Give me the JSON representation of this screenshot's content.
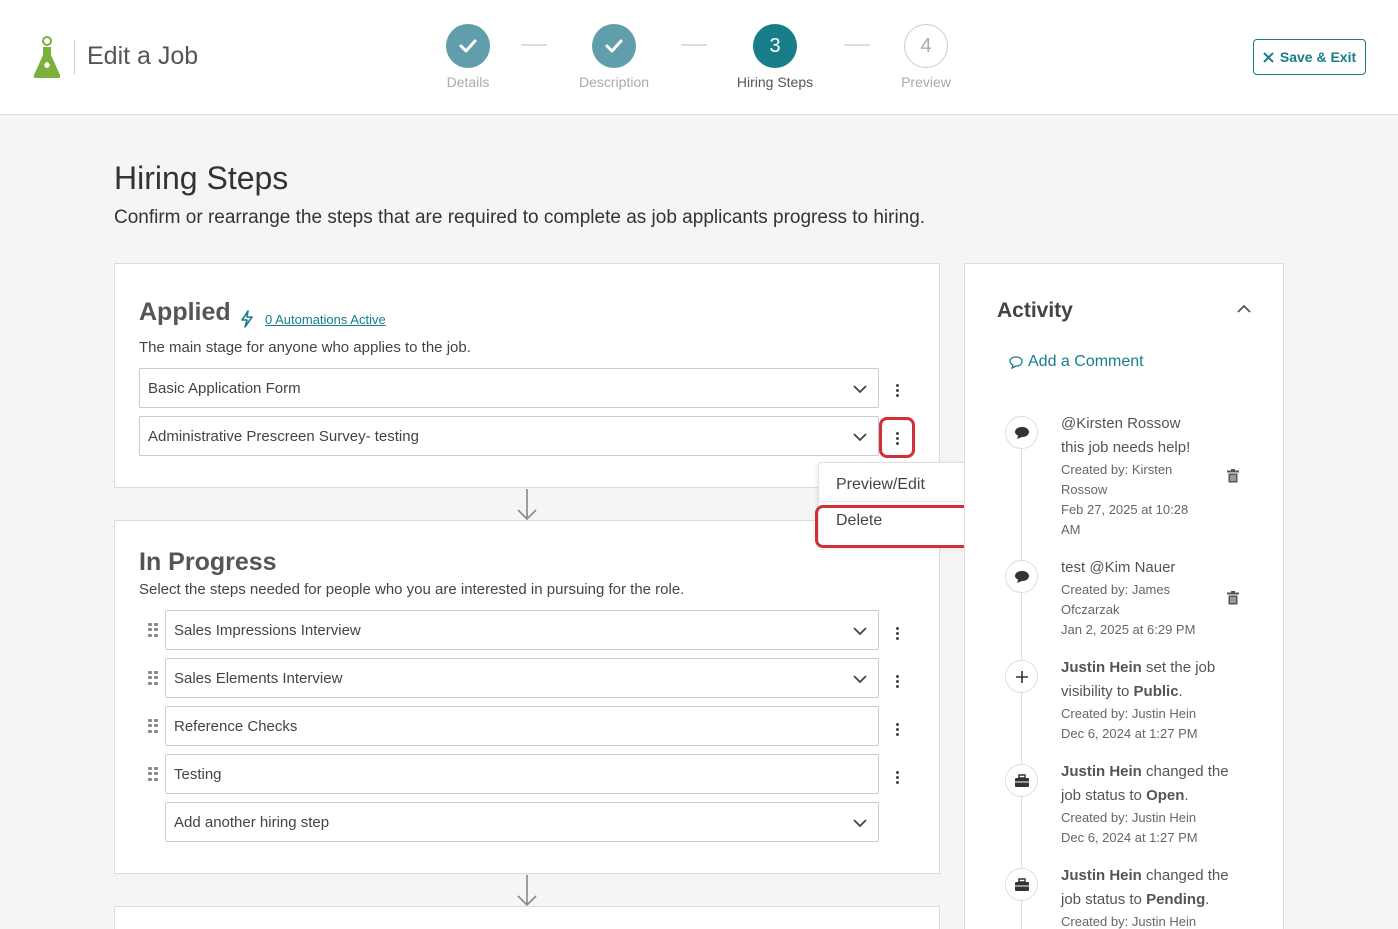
{
  "header": {
    "title": "Edit a Job",
    "save_exit_label": "Save & Exit",
    "steps": [
      {
        "number": "1",
        "label": "Details",
        "status": "done"
      },
      {
        "number": "2",
        "label": "Description",
        "status": "done"
      },
      {
        "number": "3",
        "label": "Hiring Steps",
        "status": "active"
      },
      {
        "number": "4",
        "label": "Preview",
        "status": "todo"
      }
    ]
  },
  "page": {
    "title": "Hiring Steps",
    "subtitle": "Confirm or rearrange the steps that are required to complete as job applicants progress to hiring."
  },
  "stages": {
    "applied": {
      "title": "Applied",
      "automations_link": "0 Automations Active",
      "description": "The main stage for anyone who applies to the job.",
      "steps": [
        "Basic Application Form",
        "Administrative Prescreen Survey- testing"
      ]
    },
    "in_progress": {
      "title": "In Progress",
      "description": "Select the steps needed for people who you are interested in pursuing for the role.",
      "steps": [
        "Sales Impressions Interview",
        "Sales Elements Interview",
        "Reference Checks",
        "Testing"
      ],
      "add_step_placeholder": "Add another hiring step"
    }
  },
  "context_menu": {
    "items": [
      "Preview/Edit",
      "Delete"
    ]
  },
  "activity": {
    "title": "Activity",
    "add_comment_label": "Add a Comment",
    "entries": [
      {
        "icon": "comment-icon",
        "text_lines": [
          "@Kirsten Rossow",
          "this job needs help!"
        ],
        "meta_lines": [
          "Created by: Kirsten",
          "Rossow",
          "Feb 27, 2025 at 10:28",
          "AM"
        ]
      },
      {
        "icon": "comment-icon",
        "text_lines": [
          "test @Kim Nauer"
        ],
        "meta_lines": [
          "Created by: James",
          "Ofczarzak",
          "Jan 2, 2025 at 6:29 PM"
        ]
      },
      {
        "icon": "plus-icon",
        "actor": "Justin Hein",
        "action": "set the job",
        "action2": "visibility to",
        "value": "Public",
        "meta_lines": [
          "Created by: Justin Hein",
          "Dec 6, 2024 at 1:27 PM"
        ]
      },
      {
        "icon": "briefcase-icon",
        "actor": "Justin Hein",
        "action": "changed the",
        "action2": "job status to",
        "value": "Open",
        "meta_lines": [
          "Created by: Justin Hein",
          "Dec 6, 2024 at 1:27 PM"
        ]
      },
      {
        "icon": "briefcase-icon",
        "actor": "Justin Hein",
        "action": "changed the",
        "action2": "job status to",
        "value": "Pending",
        "meta_lines": [
          "Created by: Justin Hein"
        ]
      }
    ]
  },
  "colors": {
    "brand_teal": "#177e89",
    "done_step": "#5f9eaa",
    "highlight_red": "#d0303a",
    "logo_green": "#7ab03b"
  }
}
